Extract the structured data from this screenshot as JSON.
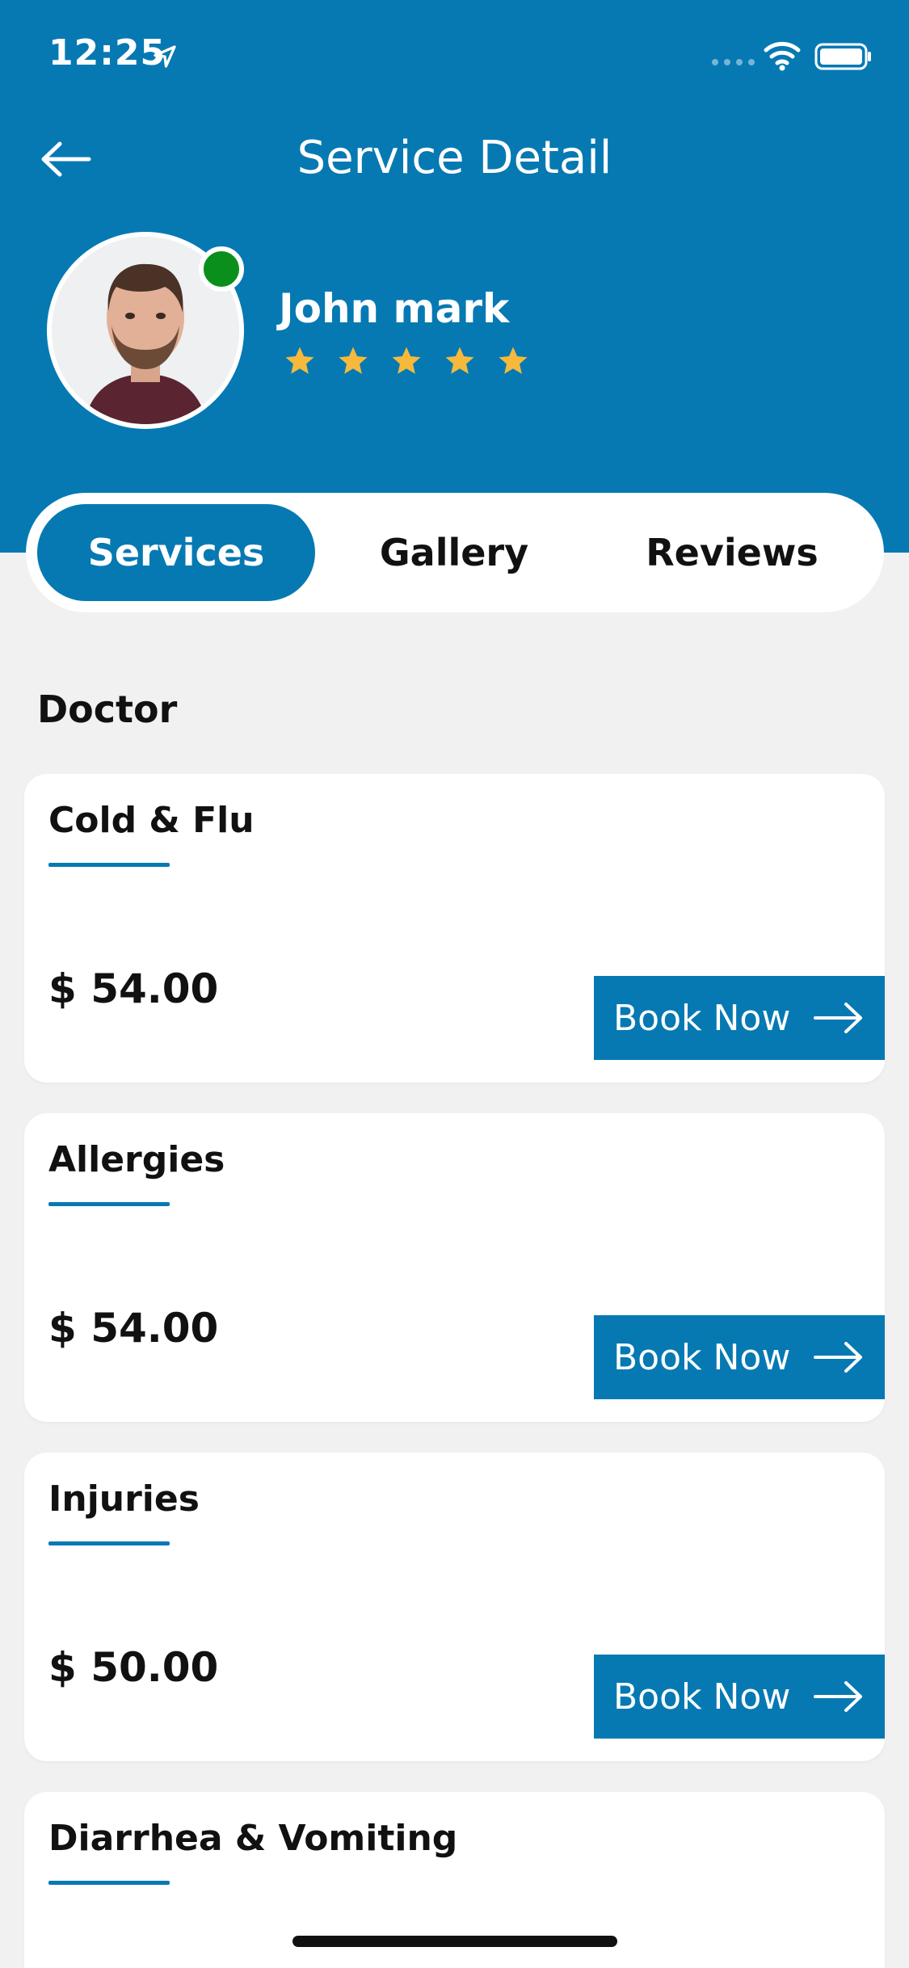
{
  "status_bar": {
    "time": "12:25"
  },
  "header": {
    "title": "Service Detail"
  },
  "profile": {
    "name": "John mark",
    "rating": 5,
    "rating_max": 5,
    "online": true
  },
  "colors": {
    "brand": "#0679b3",
    "star": "#f6b93b",
    "online": "#0a8f1c",
    "background": "#f1f1f1"
  },
  "tabs": [
    {
      "label": "Services",
      "active": true
    },
    {
      "label": "Gallery",
      "active": false
    },
    {
      "label": "Reviews",
      "active": false
    }
  ],
  "section": {
    "title": "Doctor"
  },
  "services": [
    {
      "name": "Cold & Flu",
      "price": "$ 54.00",
      "button_label": "Book Now"
    },
    {
      "name": "Allergies",
      "price": "$ 54.00",
      "button_label": "Book Now"
    },
    {
      "name": "Injuries",
      "price": "$ 50.00",
      "button_label": "Book Now"
    },
    {
      "name": "Diarrhea & Vomiting",
      "price": "",
      "button_label": ""
    }
  ],
  "icons": {
    "back": "arrow-left-icon",
    "location": "location-arrow-icon",
    "wifi": "wifi-icon",
    "battery": "battery-icon",
    "book": "arrow-right-icon",
    "star": "star-icon"
  }
}
